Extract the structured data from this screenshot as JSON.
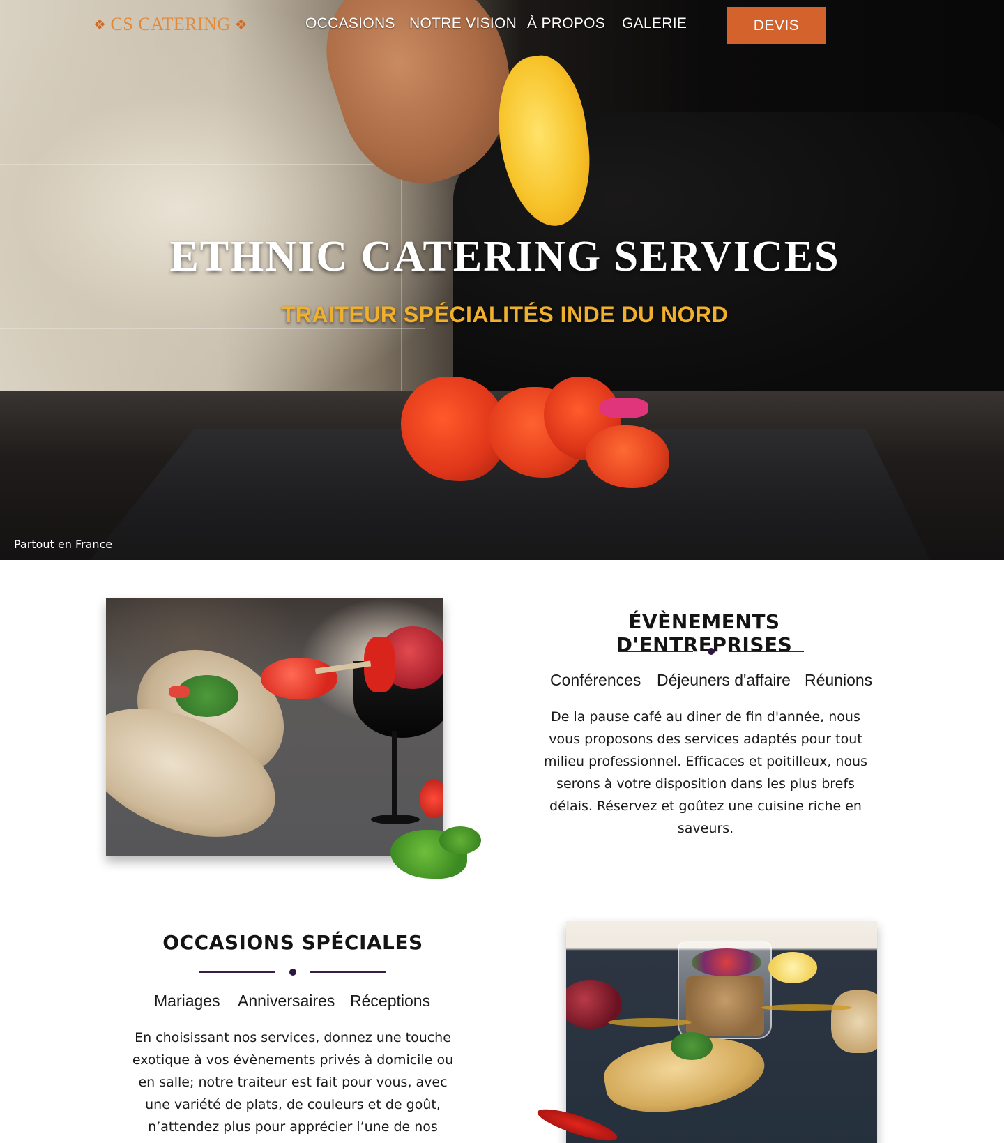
{
  "header": {
    "logo_text": "CS CATERING",
    "nav": [
      "OCCASIONS",
      "NOTRE VISION",
      "À PROPOS",
      "GALERIE"
    ],
    "cta_label": "DEVIS"
  },
  "hero": {
    "title": "ETHNIC CATERING SERVICES",
    "subtitle": "TRAITEUR SPÉCIALITÉS INDE DU NORD",
    "caption": "Partout en France"
  },
  "sections": [
    {
      "title": "ÉVÈNEMENTS D'ENTREPRISES",
      "tags": [
        "Conférences",
        "Déjeuners d'affaire",
        "Réunions"
      ],
      "text_lines": [
        "De la pause café au diner de fin d'année, nous",
        "vous proposons des services adaptés pour tout",
        "milieu professionnel. Efficaces et poitilleux, nous",
        "serons à votre disposition dans les plus brefs",
        "délais. Réservez et goûtez une cuisine riche en",
        "saveurs."
      ]
    },
    {
      "title": "OCCASIONS SPÉCIALES",
      "tags": [
        "Mariages",
        "Anniversaires",
        "Réceptions"
      ],
      "text_lines": [
        "En choisissant nos services, donnez une touche",
        "exotique à vos évènements privés à domicile ou",
        "en salle; notre traiteur est fait pour vous, avec",
        "une variété de plats, de couleurs et de goût,",
        "n’attendez plus pour apprécier l’une de nos"
      ]
    }
  ],
  "colors": {
    "accent": "#d4622c",
    "logo": "#e08a3a",
    "subtitle_gold": "#f0b02d",
    "divider_purple": "#3b1d4a"
  }
}
